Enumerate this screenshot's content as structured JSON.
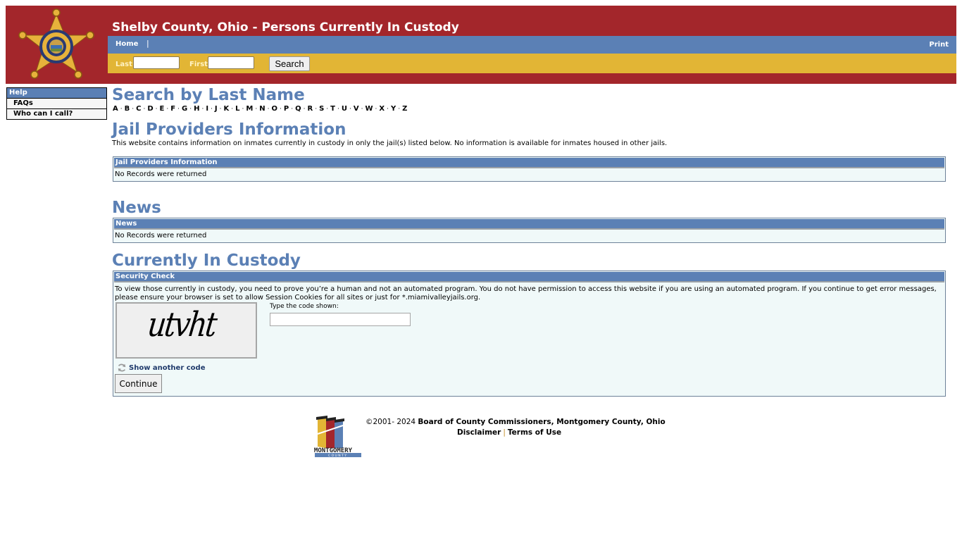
{
  "header": {
    "title": "Shelby County, Ohio - Persons Currently In Custody",
    "logo": "sheriff-star-badge",
    "nav": {
      "home": "Home",
      "separator": "|",
      "print": "Print"
    },
    "search": {
      "last_label": "Last",
      "last_value": "",
      "first_label": "First",
      "first_value": "",
      "button": "Search"
    },
    "colors": {
      "header_bg": "#a3262b",
      "nav_bg": "#5b80b5",
      "search_bg": "#e2b535"
    }
  },
  "sidebar": {
    "heading": "Help",
    "items": [
      {
        "label": "FAQs"
      },
      {
        "label": "Who can I call?"
      }
    ]
  },
  "search_by_last_name": {
    "heading": "Search by Last Name",
    "letters": [
      "A",
      "B",
      "C",
      "D",
      "E",
      "F",
      "G",
      "H",
      "I",
      "J",
      "K",
      "L",
      "M",
      "N",
      "O",
      "P",
      "Q",
      "R",
      "S",
      "T",
      "U",
      "V",
      "W",
      "X",
      "Y",
      "Z"
    ],
    "separator": "·"
  },
  "jail_providers": {
    "heading": "Jail Providers Information",
    "description": "This website contains information on inmates currently in custody in only the jail(s) listed below. No information is available for inmates housed in other jails.",
    "panel_title": "Jail Providers Information",
    "empty_message": "No Records were returned"
  },
  "news": {
    "heading": "News",
    "panel_title": "News",
    "empty_message": "No Records were returned"
  },
  "custody": {
    "heading": "Currently In Custody",
    "panel_title": "Security Check",
    "message_line1": "To view those currently in custody, you need to prove you’re a human and not an automated program. You do not have permission to access this website if you are using an automated program. If you continue to get error messages,",
    "message_line2": "please ensure your browser is set to allow Session Cookies for all sites or just for *.miamivalleyjails.org.",
    "captcha_text": "utvht",
    "code_label": "Type the code shown:",
    "code_value": "",
    "refresh_label": "Show another code",
    "continue_label": "Continue"
  },
  "footer": {
    "copyright_prefix": "©2001- 2024 ",
    "organization": "Board of County Commissioners, Montgomery County, Ohio",
    "disclaimer": "Disclaimer",
    "separator": "|",
    "terms": "Terms of Use",
    "logo_text": "MONTGOMERY",
    "logo_subtext": "C O U N T Y"
  }
}
